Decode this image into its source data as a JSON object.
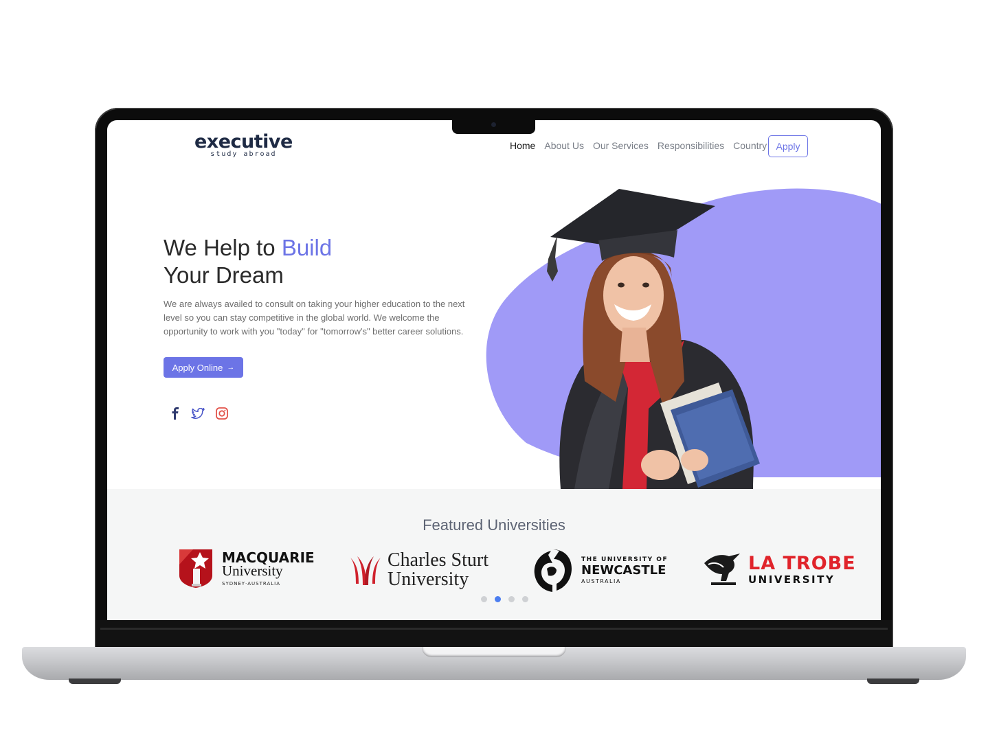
{
  "brand": {
    "name": "executive",
    "tagline": "study abroad"
  },
  "nav": {
    "items": [
      "Home",
      "About Us",
      "Our Services",
      "Responsibilities",
      "Country"
    ],
    "active": "Home",
    "apply_label": "Apply"
  },
  "hero": {
    "title_line1_plain": "We Help to ",
    "title_line1_accent": "Build",
    "title_line2": "Your Dream",
    "description": "We are always availed to consult on taking your higher education to the next level so you can stay competitive in the global world. We welcome the opportunity to work with you \"today\" for \"tomorrow's\" better career solutions.",
    "cta_label": "Apply Online",
    "cta_arrow": "→"
  },
  "social": [
    "facebook-icon",
    "twitter-icon",
    "instagram-icon"
  ],
  "featured": {
    "title": "Featured Universities",
    "universities": [
      {
        "line1": "MACQUARIE",
        "line2": "University",
        "line3": "SYDNEY·AUSTRALIA"
      },
      {
        "line1": "Charles Sturt",
        "line2": "University"
      },
      {
        "line1": "THE UNIVERSITY OF",
        "line2": "NEWCASTLE",
        "line3": "AUSTRALIA"
      },
      {
        "line1": "LA TROBE",
        "line2": "UNIVERSITY"
      }
    ],
    "carousel_total": 4,
    "carousel_active": 2
  },
  "colors": {
    "accent": "#6c74e6",
    "blob": "#a09af7",
    "navy": "#1e2a44",
    "latrobe_red": "#e0242b",
    "macquarie_red": "#b5121b"
  }
}
